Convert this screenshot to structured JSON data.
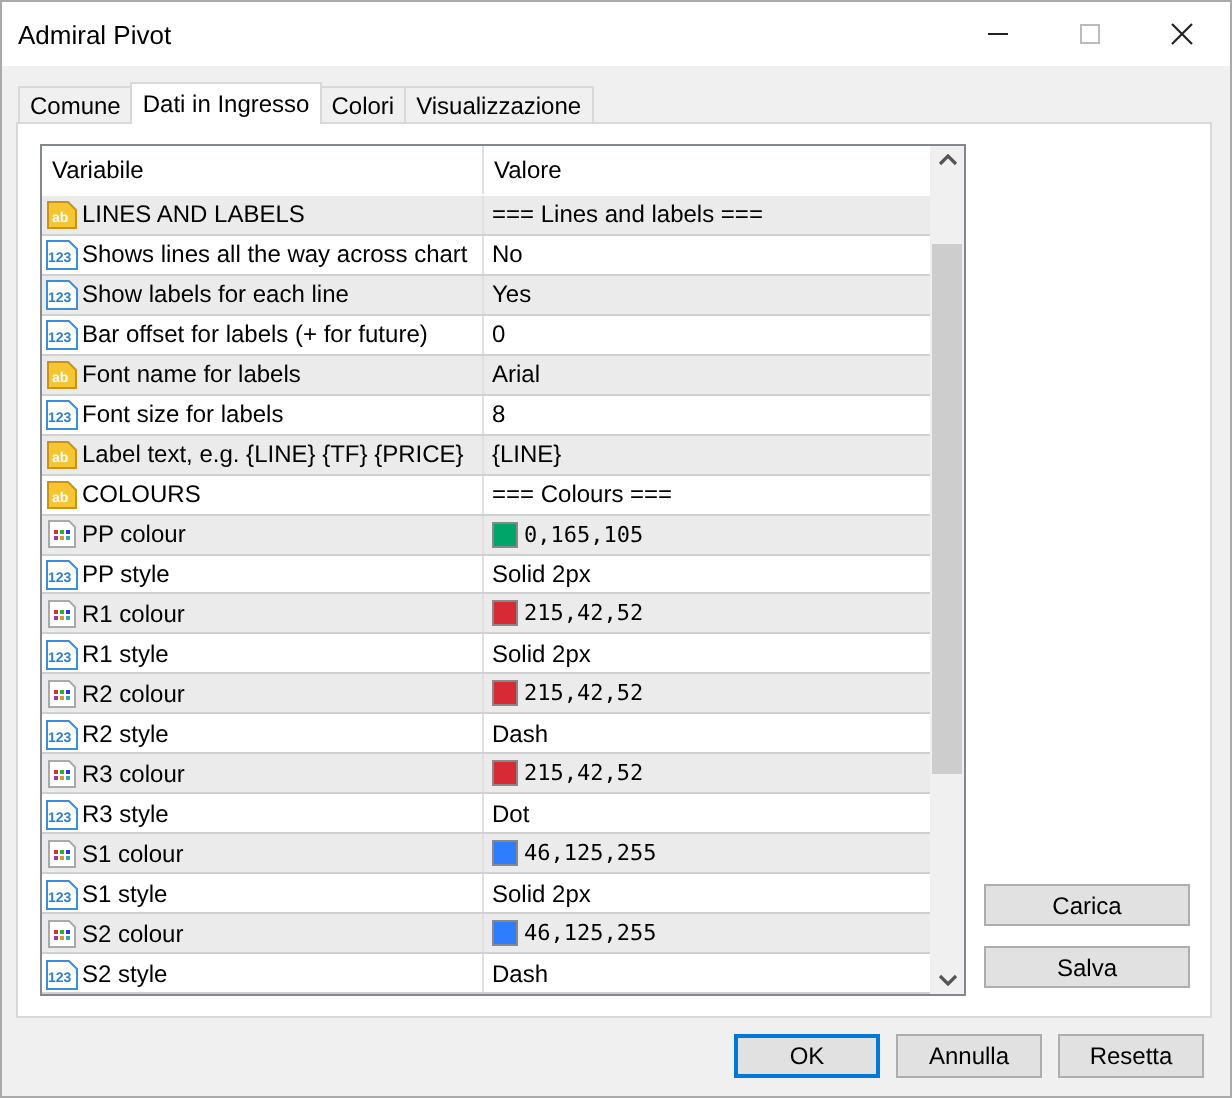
{
  "window": {
    "title": "Admiral Pivot"
  },
  "tabs": [
    {
      "label": "Comune",
      "selected": false
    },
    {
      "label": "Dati in Ingresso",
      "selected": true
    },
    {
      "label": "Colori",
      "selected": false
    },
    {
      "label": "Visualizzazione",
      "selected": false
    }
  ],
  "table": {
    "columns": [
      "Variabile",
      "Valore"
    ],
    "rows": [
      {
        "kind": "string",
        "icon_text": "ab",
        "name": "LINES AND LABELS",
        "value": "=== Lines and labels ==="
      },
      {
        "kind": "number",
        "icon_text": "123",
        "name": "Shows lines all the way across chart",
        "value": "No"
      },
      {
        "kind": "number",
        "icon_text": "123",
        "name": "Show labels for each line",
        "value": "Yes"
      },
      {
        "kind": "number",
        "icon_text": "123",
        "name": "Bar offset for labels (+ for future)",
        "value": "0"
      },
      {
        "kind": "string",
        "icon_text": "ab",
        "name": "Font name for labels",
        "value": "Arial"
      },
      {
        "kind": "number",
        "icon_text": "123",
        "name": "Font size for labels",
        "value": "8"
      },
      {
        "kind": "string",
        "icon_text": "ab",
        "name": "Label text, e.g. {LINE} {TF} {PRICE}",
        "value": "{LINE}"
      },
      {
        "kind": "string",
        "icon_text": "ab",
        "name": "COLOURS",
        "value": "=== Colours ==="
      },
      {
        "kind": "color",
        "name": "PP colour",
        "value": "0,165,105",
        "color": "#00a569"
      },
      {
        "kind": "number",
        "icon_text": "123",
        "name": "PP style",
        "value": "Solid 2px"
      },
      {
        "kind": "color",
        "name": "R1 colour",
        "value": "215,42,52",
        "color": "#d72a34"
      },
      {
        "kind": "number",
        "icon_text": "123",
        "name": "R1 style",
        "value": "Solid 2px"
      },
      {
        "kind": "color",
        "name": "R2 colour",
        "value": "215,42,52",
        "color": "#d72a34"
      },
      {
        "kind": "number",
        "icon_text": "123",
        "name": "R2 style",
        "value": "Dash"
      },
      {
        "kind": "color",
        "name": "R3 colour",
        "value": "215,42,52",
        "color": "#d72a34"
      },
      {
        "kind": "number",
        "icon_text": "123",
        "name": "R3 style",
        "value": "Dot"
      },
      {
        "kind": "color",
        "name": "S1 colour",
        "value": "46,125,255",
        "color": "#2e7dff"
      },
      {
        "kind": "number",
        "icon_text": "123",
        "name": "S1 style",
        "value": "Solid 2px"
      },
      {
        "kind": "color",
        "name": "S2 colour",
        "value": "46,125,255",
        "color": "#2e7dff"
      },
      {
        "kind": "number",
        "icon_text": "123",
        "name": "S2 style",
        "value": "Dash"
      }
    ]
  },
  "side_buttons": [
    "Carica",
    "Salva"
  ],
  "buttons": [
    {
      "label": "OK",
      "default": true
    },
    {
      "label": "Annulla",
      "default": false
    },
    {
      "label": "Resetta",
      "default": false
    }
  ]
}
